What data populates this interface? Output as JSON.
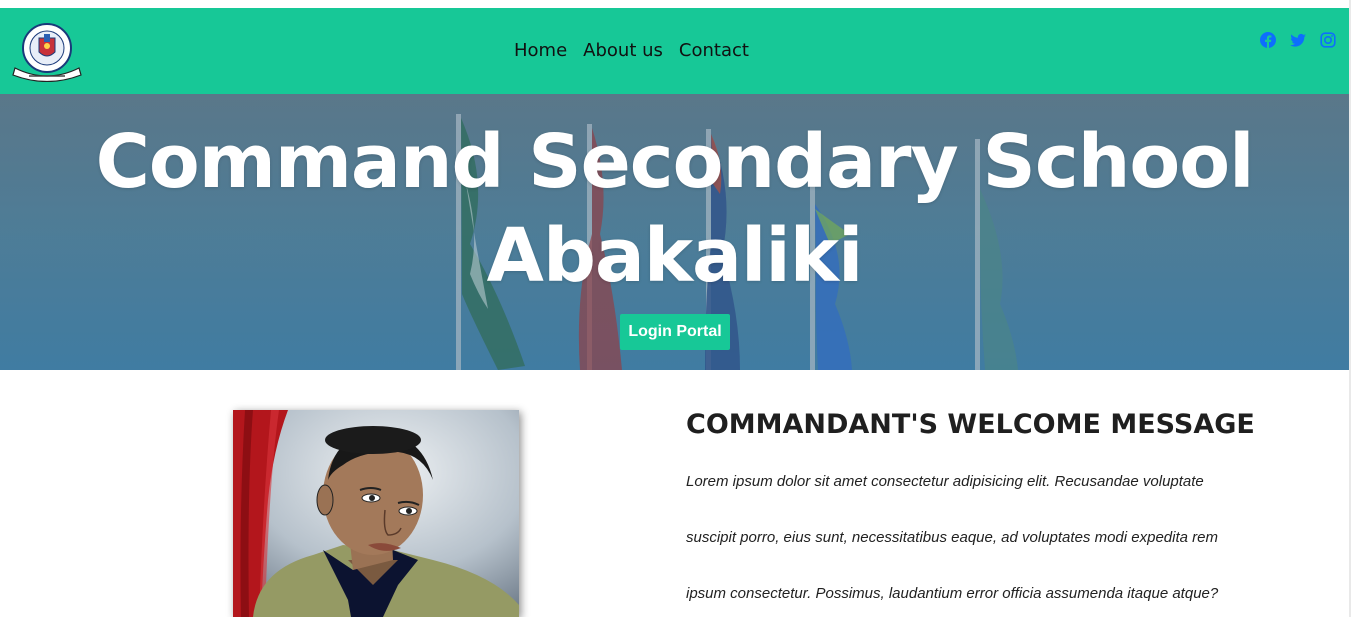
{
  "nav": {
    "links": [
      "Home",
      "About us",
      "Contact"
    ],
    "socials": [
      "facebook-icon",
      "twitter-icon",
      "instagram-icon"
    ],
    "social_color": "#0d6efd",
    "bg_color": "#17c897"
  },
  "logo": {
    "icon": "school-crest-logo"
  },
  "hero": {
    "title_line1": "Command Secondary School",
    "title_line2": "Abakaliki",
    "login_label": "Login Portal"
  },
  "welcome": {
    "heading": "COMMANDANT'S WELCOME MESSAGE",
    "lines": [
      "Lorem ipsum dolor sit amet consectetur adipisicing elit. Recusandae voluptate",
      "suscipit porro, eius sunt, necessitatibus eaque, ad voluptates modi expedita rem",
      "ipsum consectetur. Possimus, laudantium error officia assumenda itaque atque?"
    ]
  }
}
